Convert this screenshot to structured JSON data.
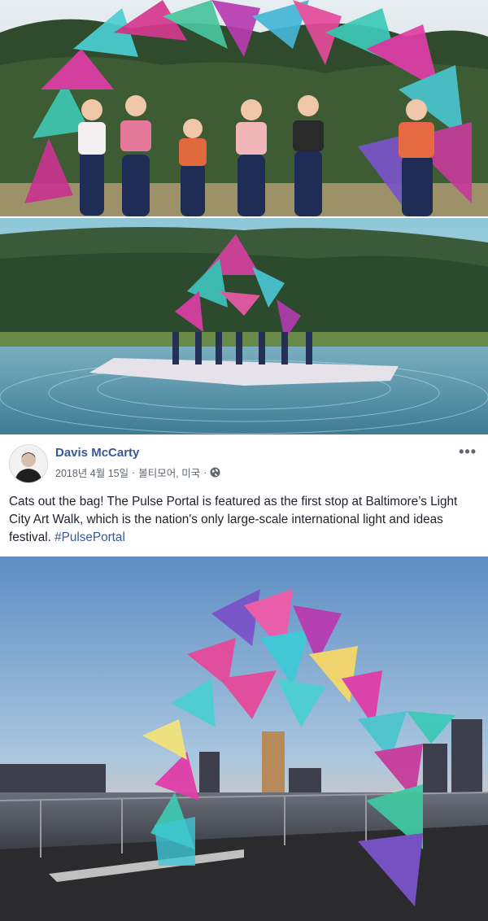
{
  "post": {
    "author": "Davis McCarty",
    "date": "2018년 4월 15일",
    "location": "볼티모어, 미국",
    "separator": "·",
    "text": "Cats out the bag! The Pulse Portal is featured as the first stop at Baltimore’s Light City Art Walk, which is the nation's only large-scale international light and ideas festival.",
    "hashtag": "#PulsePortal",
    "more_label": "•••",
    "icons": {
      "privacy": "globe-icon",
      "options": "more-options-icon"
    }
  },
  "colors": {
    "link": "#385898",
    "meta": "#606770",
    "text": "#1d2129"
  }
}
